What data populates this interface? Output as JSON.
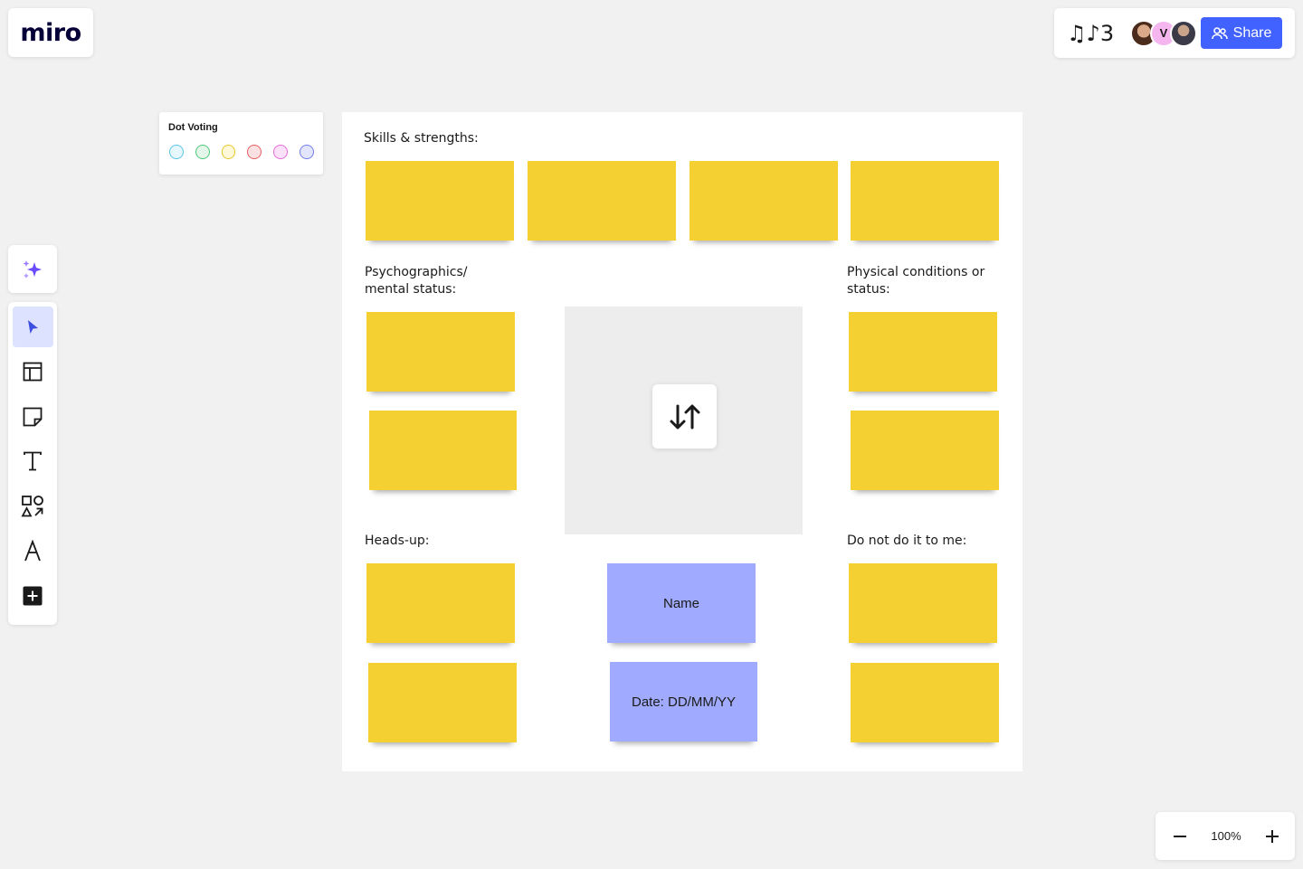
{
  "app": {
    "logo_text": "miro"
  },
  "topbar": {
    "board_title": "♫♪3",
    "avatars": [
      {
        "name": "collaborator-1",
        "initial": ""
      },
      {
        "name": "collaborator-2",
        "initial": "V"
      },
      {
        "name": "collaborator-3",
        "initial": ""
      }
    ],
    "share_label": "Share"
  },
  "dot_voting": {
    "title": "Dot Voting",
    "dot_colors": [
      "#5ac3e8",
      "#4fc77b",
      "#e5c829",
      "#e55d63",
      "#e56ad9",
      "#6f7ee8"
    ]
  },
  "toolbar": {
    "tools": [
      {
        "name": "select-tool",
        "icon": "cursor-icon",
        "active": true
      },
      {
        "name": "templates-tool",
        "icon": "templates-icon",
        "active": false
      },
      {
        "name": "sticky-note-tool",
        "icon": "sticky-note-icon",
        "active": false
      },
      {
        "name": "text-tool",
        "icon": "text-icon",
        "active": false
      },
      {
        "name": "shapes-tool",
        "icon": "shapes-icon",
        "active": false
      },
      {
        "name": "pen-tool",
        "icon": "pen-icon",
        "active": false
      },
      {
        "name": "more-tools",
        "icon": "plus-square-icon",
        "active": false
      }
    ]
  },
  "board": {
    "sections": {
      "skills": "Skills & strengths:",
      "psycho_line1": "Psychographics/",
      "psycho_line2": "mental status:",
      "physical_line1": "Physical conditions or",
      "physical_line2": "status:",
      "heads_up": "Heads-up:",
      "do_not": "Do not do it to me:"
    },
    "name_note": "Name",
    "date_note": "Date: DD/MM/YY",
    "sticky_color": "#f5d033",
    "blue_note_color": "#a0abff"
  },
  "zoom": {
    "value": "100%"
  }
}
